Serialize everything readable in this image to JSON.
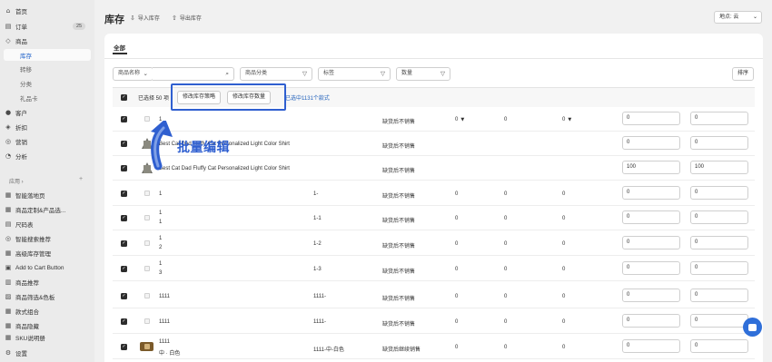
{
  "sidebar": {
    "items": [
      {
        "icon": "⌂",
        "icon_name": "home-icon",
        "label": "首页"
      },
      {
        "icon": "▤",
        "icon_name": "orders-icon",
        "label": "订单"
      },
      {
        "icon": "◇",
        "icon_name": "products-icon",
        "label": "商品"
      },
      {
        "label": "库存"
      },
      {
        "label": "转移"
      },
      {
        "label": "分类"
      },
      {
        "label": "礼品卡"
      },
      {
        "icon": "●",
        "icon_name": "customer-icon",
        "label": "客户"
      },
      {
        "icon": "◈",
        "icon_name": "discount-icon",
        "label": "折扣"
      },
      {
        "icon": "◎",
        "icon_name": "marketing-icon",
        "label": "营销"
      },
      {
        "icon": "◔",
        "icon_name": "analytics-icon",
        "label": "分析"
      }
    ],
    "orders_badge": "25",
    "apps_label": "应用 ›",
    "apps": [
      {
        "icon": "▦",
        "label": "智能落地页"
      },
      {
        "icon": "▦",
        "label": "商品定制&产品选..."
      },
      {
        "icon": "▤",
        "label": "尺码表"
      },
      {
        "icon": "◎",
        "label": "智能搜索推荐"
      },
      {
        "icon": "▦",
        "label": "高级库存管理"
      },
      {
        "icon": "▣",
        "label": "Add to Cart Button"
      },
      {
        "icon": "▥",
        "label": "商品推荐"
      },
      {
        "icon": "▨",
        "label": "商品筛选&色板"
      },
      {
        "icon": "▦",
        "label": "款式组合"
      },
      {
        "icon": "▦",
        "label": "商品隐藏"
      },
      {
        "icon": "▦",
        "label": "SKU说明册"
      }
    ],
    "settings": {
      "icon": "⚙",
      "label": "设置"
    }
  },
  "header": {
    "title": "库存",
    "import": "导入库存",
    "export": "导出库存",
    "location": "地点: 云"
  },
  "tabs": {
    "all": "全部"
  },
  "filters": {
    "product_name": "商品名称",
    "product_category": "商品分类",
    "tag": "标签",
    "quantity": "数量",
    "sort": "排序"
  },
  "selection": {
    "text": "已选择 50 项",
    "btn_policy": "修改库存策略",
    "btn_qty": "修改库存数量",
    "select_all": "已选中1131个款式"
  },
  "annotation": {
    "text": "批量编辑"
  },
  "rows": [
    {
      "thumb": "placeholder",
      "name": "1",
      "name2": "",
      "sku": "",
      "policy": "缺货后不销售",
      "avail": "0",
      "committed": "0",
      "onhand": "0",
      "v1": "0",
      "v2": "0",
      "dd": true
    },
    {
      "thumb": "shirt",
      "name": "Best Cat Dad Fluffy Cat Personalized Light Color Shirt",
      "name2": "",
      "sku": "",
      "policy": "缺货后不销售",
      "avail": "",
      "committed": "",
      "onhand": "",
      "v1": "0",
      "v2": "0",
      "dd": false
    },
    {
      "thumb": "shirt",
      "name": "Best Cat Dad Fluffy Cat Personalized Light Color Shirt",
      "name2": "",
      "sku": "",
      "policy": "缺货后不销售",
      "avail": "",
      "committed": "",
      "onhand": "",
      "v1": "100",
      "v2": "100",
      "dd": false
    },
    {
      "thumb": "placeholder",
      "name": "1",
      "name2": "",
      "sku": "1-",
      "policy": "缺货后不销售",
      "avail": "0",
      "committed": "0",
      "onhand": "0",
      "v1": "0",
      "v2": "0",
      "dd": false
    },
    {
      "thumb": "placeholder",
      "name": "1",
      "name2": "1",
      "sku": "1-1",
      "policy": "缺货后不销售",
      "avail": "0",
      "committed": "0",
      "onhand": "0",
      "v1": "0",
      "v2": "0",
      "dd": false
    },
    {
      "thumb": "placeholder",
      "name": "1",
      "name2": "2",
      "sku": "1-2",
      "policy": "缺货后不销售",
      "avail": "0",
      "committed": "0",
      "onhand": "0",
      "v1": "0",
      "v2": "0",
      "dd": false
    },
    {
      "thumb": "placeholder",
      "name": "1",
      "name2": "3",
      "sku": "1-3",
      "policy": "缺货后不销售",
      "avail": "0",
      "committed": "0",
      "onhand": "0",
      "v1": "0",
      "v2": "0",
      "dd": false
    },
    {
      "thumb": "placeholder",
      "name": "1111",
      "name2": "",
      "sku": "1111-",
      "policy": "缺货后不销售",
      "avail": "0",
      "committed": "0",
      "onhand": "0",
      "v1": "0",
      "v2": "0",
      "dd": false
    },
    {
      "thumb": "placeholder",
      "name": "1111",
      "name2": "",
      "sku": "1111-",
      "policy": "缺货后不销售",
      "avail": "0",
      "committed": "0",
      "onhand": "0",
      "v1": "0",
      "v2": "0",
      "dd": false
    },
    {
      "thumb": "mug",
      "name": "1111",
      "name2": "中 · 白色",
      "sku": "1111-中-白色",
      "policy": "缺货后继续销售",
      "avail": "0",
      "committed": "0",
      "onhand": "0",
      "v1": "0",
      "v2": "0",
      "dd": false
    }
  ]
}
